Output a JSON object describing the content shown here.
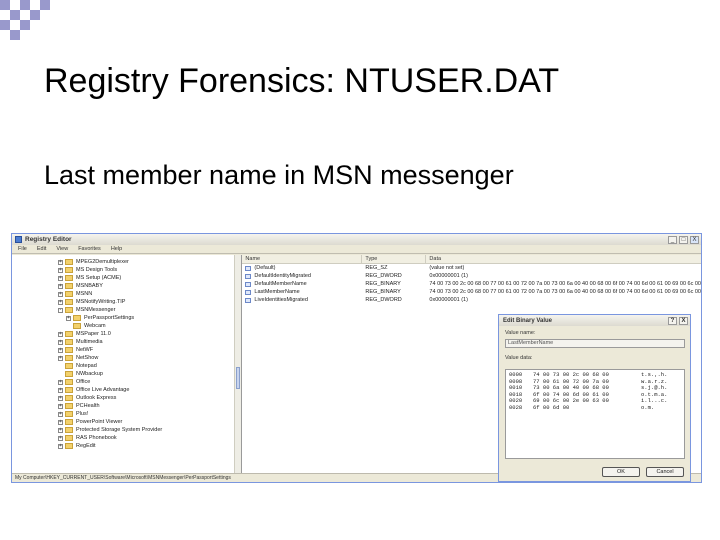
{
  "slide": {
    "title": "Registry Forensics: NTUSER.DAT",
    "subtitle": "Last member name in MSN messenger"
  },
  "regedit": {
    "title": "Registry Editor",
    "menu": [
      "File",
      "Edit",
      "View",
      "Favorites",
      "Help"
    ],
    "window_buttons": [
      "_",
      "□",
      "X"
    ],
    "tree_items": [
      {
        "label": "MPEG2Demultiplexer",
        "exp": "+"
      },
      {
        "label": "MS Design Tools",
        "exp": "+"
      },
      {
        "label": "MS Setup (ACME)",
        "exp": "+"
      },
      {
        "label": "MSNBABY",
        "exp": "+"
      },
      {
        "label": "MSNN",
        "exp": "+"
      },
      {
        "label": "MSNotifyWriting.TIP",
        "exp": "+"
      },
      {
        "label": "MSNMessenger",
        "exp": "-"
      },
      {
        "label": "PerPassportSettings",
        "exp": "+",
        "indent": 1
      },
      {
        "label": "Webcam",
        "exp": "",
        "indent": 1
      },
      {
        "label": "MSPaper 11.0",
        "exp": "+"
      },
      {
        "label": "Multimedia",
        "exp": "+"
      },
      {
        "label": "NetWF",
        "exp": "+"
      },
      {
        "label": "NetShow",
        "exp": "+"
      },
      {
        "label": "Notepad",
        "exp": ""
      },
      {
        "label": "NWbackup",
        "exp": ""
      },
      {
        "label": "Office",
        "exp": "+"
      },
      {
        "label": "Office Live Advantage",
        "exp": "+"
      },
      {
        "label": "Outlook Express",
        "exp": "+"
      },
      {
        "label": "PCHealth",
        "exp": "+"
      },
      {
        "label": "Plus!",
        "exp": "+"
      },
      {
        "label": "PowerPoint Viewer",
        "exp": "+"
      },
      {
        "label": "Protected Storage System Provider",
        "exp": "+"
      },
      {
        "label": "RAS Phonebook",
        "exp": "+"
      },
      {
        "label": "RegEdit",
        "exp": "+"
      }
    ],
    "list_columns": [
      "Name",
      "Type",
      "Data"
    ],
    "list_rows": [
      {
        "name": "(Default)",
        "type": "REG_SZ",
        "data": "(value not set)"
      },
      {
        "name": "DefaultIdentityMigrated",
        "type": "REG_DWORD",
        "data": "0x00000001 (1)"
      },
      {
        "name": "DefaultMemberName",
        "type": "REG_BINARY",
        "data": "74 00 73 00 2c 00 68 00 77 00 61 00 72 00 7a 00 73 00 6a 00 40 00 68 00 6f 00 74 00 6d 00 61 00 69 00 6c 00"
      },
      {
        "name": "LastMemberName",
        "type": "REG_BINARY",
        "data": "74 00 73 00 2c 00 68 00 77 00 61 00 72 00 7a 00 73 00 6a 00 40 00 68 00 6f 00 74 00 6d 00 61 00 69 00 6c 00"
      },
      {
        "name": "LiveIdentitiesMigrated",
        "type": "REG_DWORD",
        "data": "0x00000001 (1)"
      }
    ],
    "status_path": "My Computer\\HKEY_CURRENT_USER\\Software\\Microsoft\\MSNMessenger\\PerPassportSettings"
  },
  "dialog": {
    "title": "Edit Binary Value",
    "buttons_title": [
      "?",
      "X"
    ],
    "value_name_label": "Value name:",
    "value_name": "LastMemberName",
    "value_data_label": "Value data:",
    "hex_rows": [
      {
        "offset": "0000",
        "bytes": "74 00 73 00 2c 00 68 00",
        "ascii": "t.s.,.h."
      },
      {
        "offset": "0008",
        "bytes": "77 00 61 00 72 00 7a 00",
        "ascii": "w.a.r.z."
      },
      {
        "offset": "0010",
        "bytes": "73 00 6a 00 40 00 68 00",
        "ascii": "s.j.@.h."
      },
      {
        "offset": "0018",
        "bytes": "6f 00 74 00 6d 00 61 00",
        "ascii": "o.t.m.a."
      },
      {
        "offset": "0020",
        "bytes": "69 00 6c 00 2e 00 63 00",
        "ascii": "i.l...c."
      },
      {
        "offset": "0028",
        "bytes": "6f 00 6d 00",
        "ascii": "o.m."
      }
    ],
    "ok_label": "OK",
    "cancel_label": "Cancel"
  }
}
